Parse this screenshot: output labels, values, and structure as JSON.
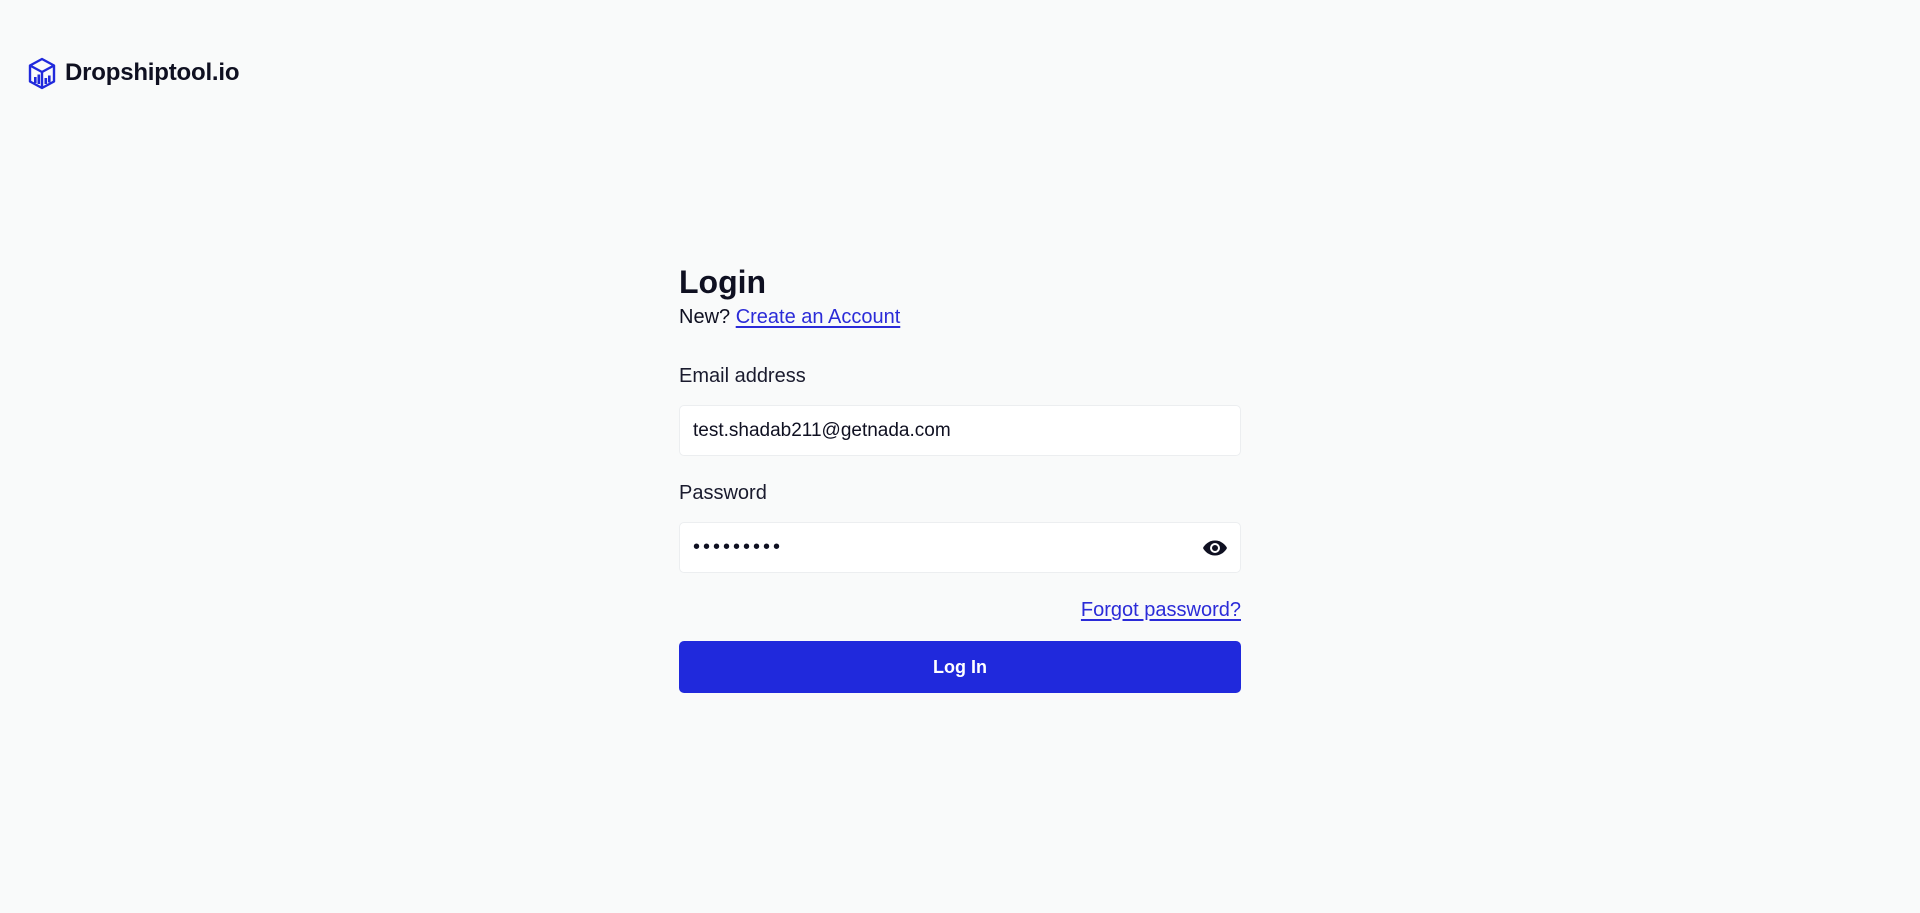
{
  "brand": {
    "name": "Dropshiptool.io",
    "logo_icon": "cube-chart-icon",
    "accent_color": "#2029dc"
  },
  "login": {
    "title": "Login",
    "new_prefix": "New?",
    "create_account_link": "Create an Account",
    "email": {
      "label": "Email address",
      "value": "test.shadab211@getnada.com"
    },
    "password": {
      "label": "Password",
      "masked_value": "•••••••••",
      "toggle_icon": "eye-icon"
    },
    "forgot_password_link": "Forgot password?",
    "submit_label": "Log In"
  }
}
